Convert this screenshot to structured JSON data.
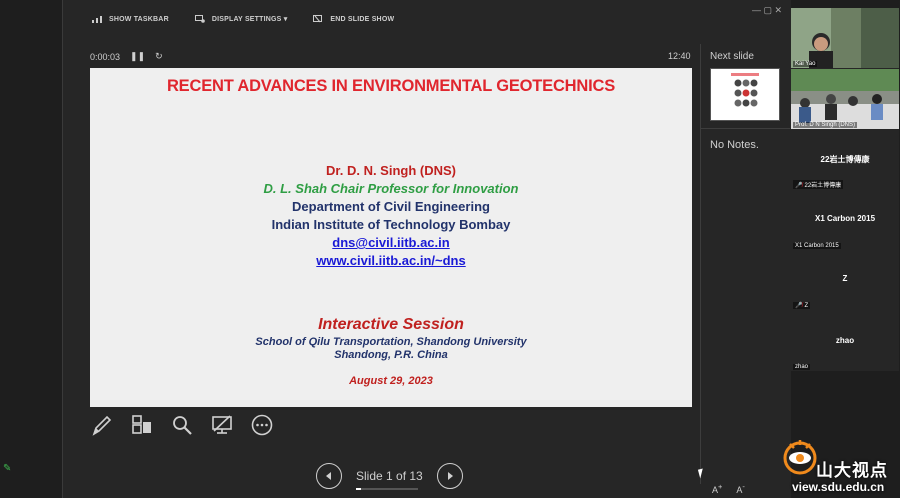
{
  "toolbar": {
    "show_taskbar": "SHOW TASKBAR",
    "display_settings": "DISPLAY SETTINGS ▾",
    "end_slide_show": "END SLIDE SHOW"
  },
  "window_controls": "—  ▢  ✕",
  "presenter": {
    "timer": "0:00:03",
    "clock": "12:40",
    "next_slide_label": "Next slide",
    "notes": "No Notes.",
    "slide_counter": "Slide 1 of 13",
    "slide_progress": 0.077
  },
  "slide": {
    "title": "RECENT ADVANCES IN ENVIRONMENTAL GEOTECHNICS",
    "name": "Dr. D. N. Singh (DNS)",
    "chair": "D. L. Shah Chair Professor for Innovation",
    "department": "Department of Civil Engineering",
    "institute": "Indian Institute of Technology Bombay",
    "email": "dns@civil.iitb.ac.in",
    "website": "www.civil.iitb.ac.in/~dns",
    "session": "Interactive Session",
    "school": "School of Qilu Transportation, Shandong University",
    "city": "Shandong, P.R. China",
    "date": "August 29, 2023"
  },
  "participants": [
    {
      "caption": "Kai Yao",
      "type": "video"
    },
    {
      "caption": "Prof. D N Singh (DNS)",
      "type": "video"
    },
    {
      "title": "22岩土博傳康",
      "caption": "22岩土博傳康",
      "muted": true
    },
    {
      "title": "X1 Carbon 2015",
      "caption": "X1 Carbon 2015",
      "muted": false
    },
    {
      "title": "Z",
      "caption": "Z",
      "muted": true
    },
    {
      "title": "zhao",
      "caption": "zhao",
      "muted": false
    }
  ],
  "watermark": {
    "text": "山大视点",
    "url": "view.sdu.edu.cn"
  },
  "colors": {
    "title_red": "#e0262e",
    "chair_green": "#2f9e44",
    "navy": "#22336b",
    "link_blue": "#1a1ad6"
  }
}
